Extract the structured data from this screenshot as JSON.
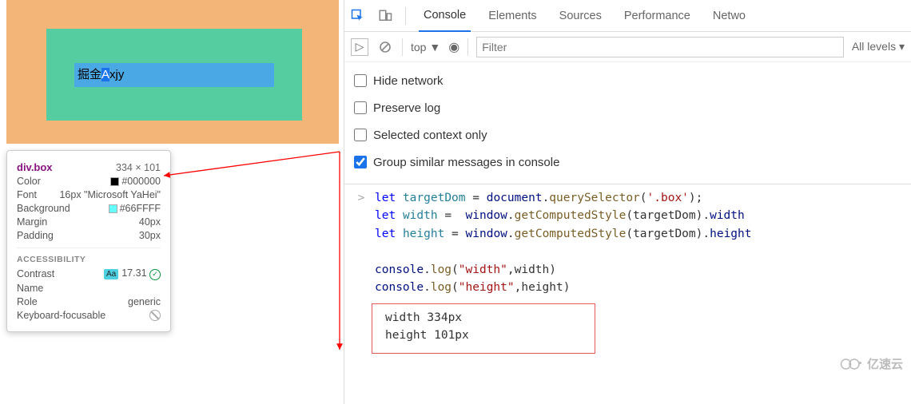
{
  "preview": {
    "box_text": "掘金",
    "box_text_sel": "A",
    "box_text_rest": "xjy"
  },
  "tooltip": {
    "selector": "div.box",
    "dimensions": "334 × 101",
    "rows": {
      "color_label": "Color",
      "color_value": "#000000",
      "color_swatch": "#000000",
      "font_label": "Font",
      "font_value": "16px \"Microsoft YaHei\"",
      "bg_label": "Background",
      "bg_value": "#66FFFF",
      "bg_swatch": "#66FFFF",
      "margin_label": "Margin",
      "margin_value": "40px",
      "padding_label": "Padding",
      "padding_value": "30px"
    },
    "a11y": {
      "title": "ACCESSIBILITY",
      "contrast_label": "Contrast",
      "contrast_badge": "Aa",
      "contrast_value": "17.31",
      "name_label": "Name",
      "name_value": "",
      "role_label": "Role",
      "role_value": "generic",
      "focusable_label": "Keyboard-focusable"
    }
  },
  "devtools": {
    "tabs": [
      "Console",
      "Elements",
      "Sources",
      "Performance",
      "Netwo"
    ],
    "active_tab_index": 0,
    "filter": {
      "context": "top",
      "filter_placeholder": "Filter",
      "levels_label": "All levels"
    },
    "options": [
      {
        "label": "Hide network",
        "checked": false
      },
      {
        "label": "Preserve log",
        "checked": false
      },
      {
        "label": "Selected context only",
        "checked": false
      },
      {
        "label": "Group similar messages in console",
        "checked": true
      }
    ],
    "code": {
      "l1": {
        "kw": "let",
        "id": "targetDom",
        "eq": " = ",
        "obj": "document",
        "dot": ".",
        "m": "querySelector",
        "paren": "(",
        "str": "'.box'",
        "close": ");"
      },
      "l2": {
        "kw": "let",
        "id": "width",
        "eq": " =  ",
        "obj": "window",
        "dot": ".",
        "m": "getComputedStyle",
        "paren": "(targetDom).",
        "prop": "width"
      },
      "l3": {
        "kw": "let",
        "id": "height",
        "eq": " = ",
        "obj": "window",
        "dot": ".",
        "m": "getComputedStyle",
        "paren": "(targetDom).",
        "prop": "height"
      },
      "l4a": "console",
      "l4b": ".",
      "l4c": "log",
      "l4d": "(",
      "l4e": "\"width\"",
      "l4f": ",width)",
      "l5a": "console",
      "l5b": ".",
      "l5c": "log",
      "l5d": "(",
      "l5e": "\"height\"",
      "l5f": ",height)"
    },
    "output": {
      "line1": "width 334px",
      "line2": "height 101px"
    }
  },
  "watermark": "亿速云"
}
